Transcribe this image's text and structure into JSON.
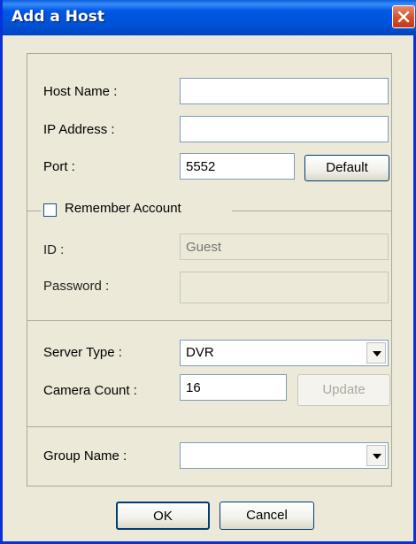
{
  "window": {
    "title": "Add a Host"
  },
  "form": {
    "host_name": {
      "label": "Host Name :",
      "value": ""
    },
    "ip_address": {
      "label": "IP Address :",
      "value": ""
    },
    "port": {
      "label": "Port :",
      "value": "5552",
      "default_button": "Default"
    },
    "remember_account": {
      "label": "Remember Account",
      "checked": false
    },
    "id": {
      "label": "ID :",
      "placeholder": "Guest",
      "value": ""
    },
    "password": {
      "label": "Password :",
      "value": ""
    },
    "server_type": {
      "label": "Server Type :",
      "selected": "DVR"
    },
    "camera_count": {
      "label": "Camera Count :",
      "value": "16",
      "update_button": "Update"
    },
    "group_name": {
      "label": "Group Name :",
      "selected": ""
    }
  },
  "buttons": {
    "ok": "OK",
    "cancel": "Cancel"
  },
  "colors": {
    "titlebar": "#0058e6",
    "window_bg": "#ece9d8",
    "close_button": "#d4502a"
  },
  "icons": {
    "close": "close-icon",
    "dropdown": "chevron-down-icon"
  }
}
